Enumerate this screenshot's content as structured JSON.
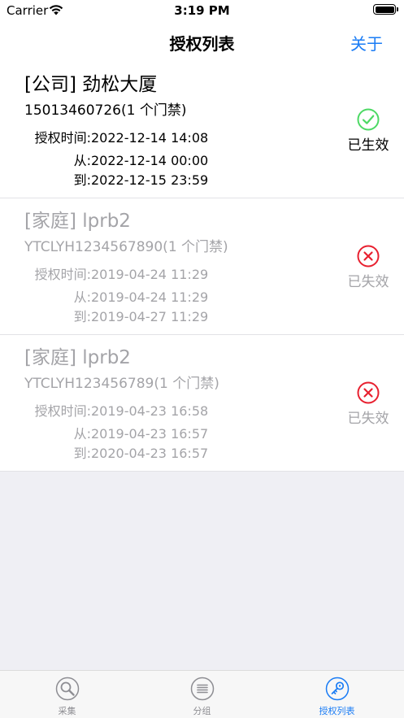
{
  "status_bar": {
    "carrier": "Carrier",
    "time": "3:19 PM"
  },
  "nav": {
    "title": "授权列表",
    "about": "关于"
  },
  "items": [
    {
      "title": "[公司] 劲松大厦",
      "subtitle": "15013460726(1 个门禁)",
      "auth_label": "授权时间:",
      "auth_time": "2022-12-14 14:08",
      "from_label": "从:",
      "from_time": "2022-12-14 00:00",
      "to_label": "到:",
      "to_time": "2022-12-15 23:59",
      "status": "已生效",
      "status_icon": "check-circle-icon"
    },
    {
      "title": "[家庭] lprb2",
      "subtitle": "YTCLYH1234567890(1 个门禁)",
      "auth_label": "授权时间:",
      "auth_time": "2019-04-24 11:29",
      "from_label": "从:",
      "from_time": "2019-04-24 11:29",
      "to_label": "到:",
      "to_time": "2019-04-27 11:29",
      "status": "已失效",
      "status_icon": "x-circle-icon"
    },
    {
      "title": "[家庭] lprb2",
      "subtitle": "YTCLYH123456789(1 个门禁)",
      "auth_label": "授权时间:",
      "auth_time": "2019-04-23 16:58",
      "from_label": "从:",
      "from_time": "2019-04-23 16:57",
      "to_label": "到:",
      "to_time": "2020-04-23 16:57",
      "status": "已失效",
      "status_icon": "x-circle-icon"
    }
  ],
  "tabs": [
    {
      "label": "采集",
      "icon": "search-icon"
    },
    {
      "label": "分组",
      "icon": "list-icon"
    },
    {
      "label": "授权列表",
      "icon": "key-icon"
    }
  ],
  "colors": {
    "accent": "#1a7cf5",
    "valid_green": "#4cd964",
    "invalid_red": "#e8202f",
    "muted_text": "#a4a4a8",
    "background": "#efeff4"
  }
}
